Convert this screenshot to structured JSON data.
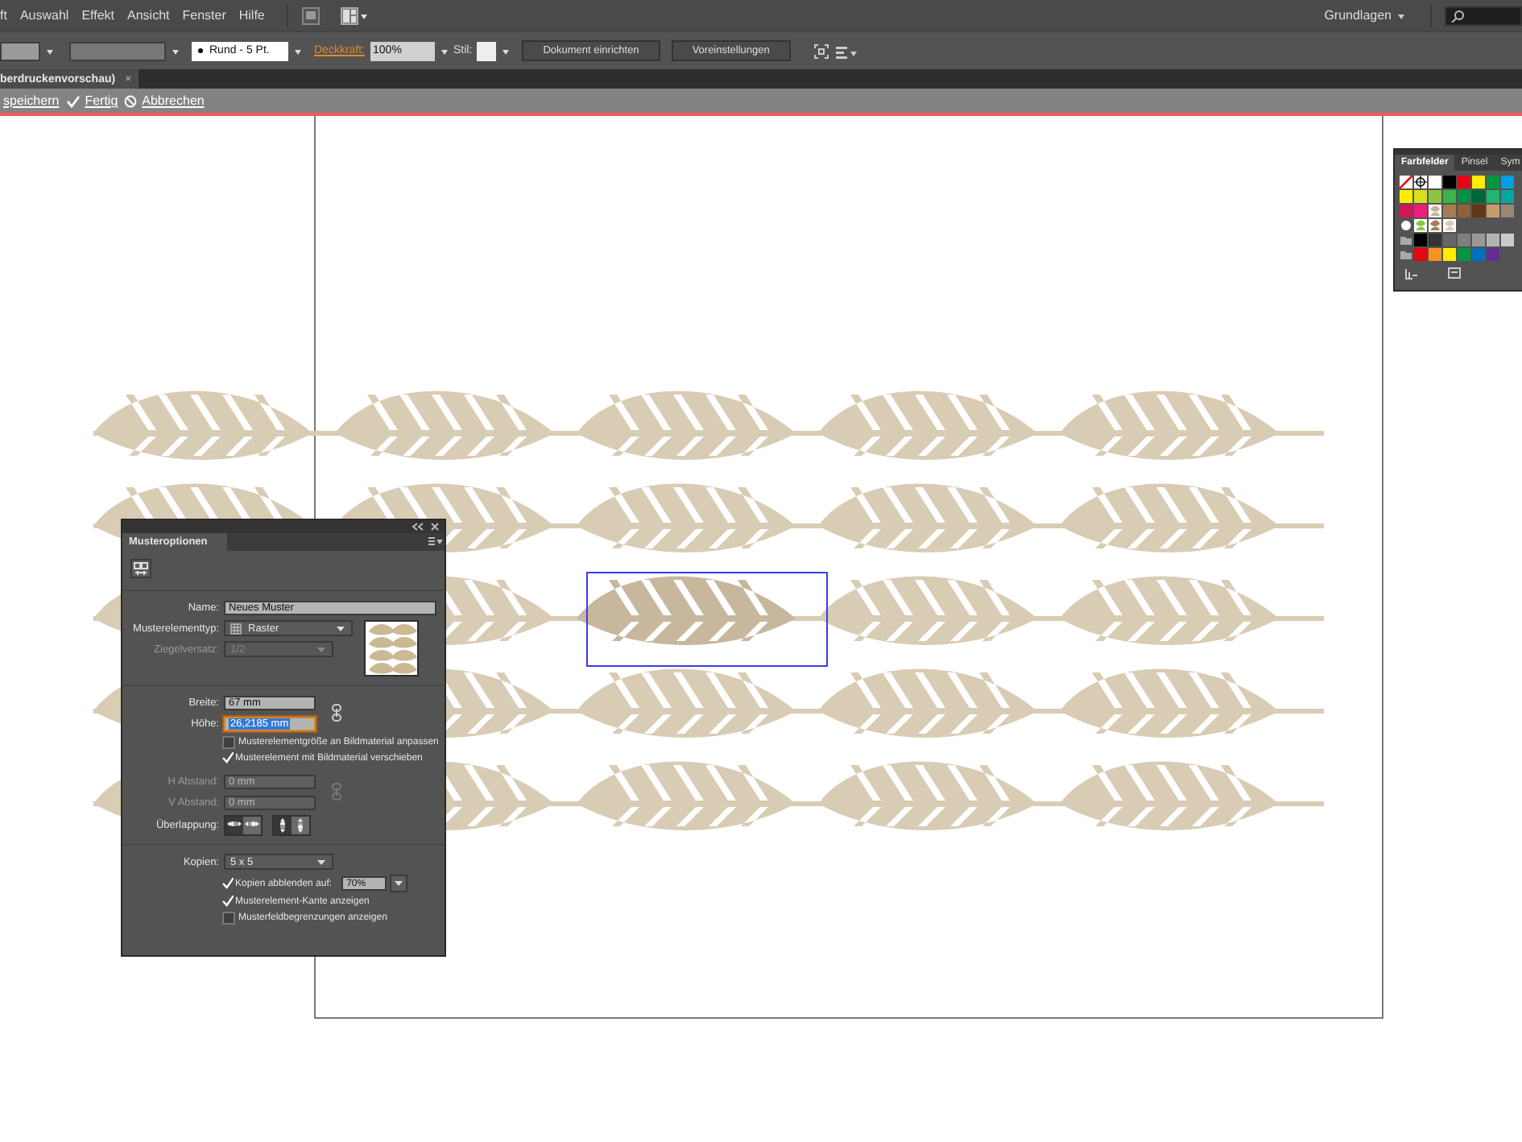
{
  "menu_bar": {
    "items": [
      "ft",
      "Auswahl",
      "Effekt",
      "Ansicht",
      "Fenster",
      "Hilfe"
    ],
    "workspace": "Grundlagen"
  },
  "control_bar": {
    "brush": "Rund - 5 Pt.",
    "opacity_label": "Deckkraft:",
    "opacity": "100%",
    "style_label": "Stil:",
    "buttons": [
      "Dokument einrichten",
      "Voreinstellungen"
    ]
  },
  "document_tab": {
    "title": "berdruckenvorschau)",
    "close": "×"
  },
  "pattern_edit_bar": {
    "items": [
      {
        "kind": "save",
        "label": "speichern"
      },
      {
        "kind": "done",
        "label": "Fertig"
      },
      {
        "kind": "cancel",
        "label": "Abbrechen"
      }
    ]
  },
  "pattern_options": {
    "title": "Musteroptionen",
    "name": {
      "label": "Name:",
      "value": "Neues Muster"
    },
    "tile_type": {
      "label": "Musterelementtyp:",
      "value": "Raster"
    },
    "brick_offset": {
      "label": "Ziegelversatz:",
      "value": "1/2",
      "disabled": true
    },
    "width": {
      "label": "Breite:",
      "value": "67 mm",
      "focused": false
    },
    "height": {
      "label": "Höhe:",
      "value": "26,2185 mm",
      "focused": true
    },
    "size_tile_to_art": {
      "label": "Musterelementgröße an Bildmaterial anpassen",
      "checked": false
    },
    "move_tile_with_art": {
      "label": "Musterelement mit Bildmaterial verschieben",
      "checked": true
    },
    "h_spacing": {
      "label": "H Abstand:",
      "value": "0 mm",
      "disabled": true
    },
    "v_spacing": {
      "label": "V Abstand:",
      "value": "0 mm",
      "disabled": true
    },
    "overlap": {
      "label": "Überlappung:",
      "buttons": [
        {
          "selected": true
        },
        {
          "selected": false
        },
        {
          "selected": true
        },
        {
          "selected": false
        }
      ]
    },
    "copies": {
      "label": "Kopien:",
      "value": "5 x 5"
    },
    "dim_copies": {
      "label": "Kopien abblenden auf:",
      "checked": true,
      "value": "70%"
    },
    "show_tile_edge": {
      "label": "Musterelement-Kante anzeigen",
      "checked": true
    },
    "show_swatch_bounds": {
      "label": "Musterfeldbegrenzungen anzeigen",
      "checked": false
    }
  },
  "swatches_panel": {
    "tabs": [
      {
        "label": "Farbfelder",
        "selected": true
      },
      {
        "label": "Pinsel",
        "selected": false
      },
      {
        "label": "Sym",
        "selected": false
      }
    ],
    "rows": [
      [
        {
          "kind": "none"
        },
        {
          "kind": "registration"
        },
        {
          "kind": "color",
          "color": "#ffffff"
        },
        {
          "kind": "color",
          "color": "#000000"
        },
        {
          "kind": "color",
          "color": "#e30613"
        },
        {
          "kind": "color",
          "color": "#ffed00"
        },
        {
          "kind": "color",
          "color": "#009640"
        },
        {
          "kind": "color",
          "color": "#009fe3"
        }
      ],
      [
        {
          "kind": "color",
          "color": "#ffed00"
        },
        {
          "kind": "color",
          "color": "#d9e021"
        },
        {
          "kind": "color",
          "color": "#8cc63f"
        },
        {
          "kind": "color",
          "color": "#39b54a"
        },
        {
          "kind": "color",
          "color": "#009245"
        },
        {
          "kind": "color",
          "color": "#006837"
        },
        {
          "kind": "color",
          "color": "#22b573"
        },
        {
          "kind": "color",
          "color": "#00a99d"
        }
      ],
      [
        {
          "kind": "color",
          "color": "#d4145a"
        },
        {
          "kind": "color",
          "color": "#ed1e79"
        },
        {
          "kind": "pattern",
          "color": "#c7b299"
        },
        {
          "kind": "color",
          "color": "#a67c52"
        },
        {
          "kind": "color",
          "color": "#8c6239"
        },
        {
          "kind": "color",
          "color": "#603813"
        },
        {
          "kind": "color",
          "color": "#c69c6d"
        },
        {
          "kind": "color",
          "color": "#998675"
        }
      ],
      [
        {
          "kind": "dots"
        },
        {
          "kind": "pattern",
          "color": "#8cc63f"
        },
        {
          "kind": "pattern",
          "color": "#a67c52"
        },
        {
          "kind": "pattern",
          "color": "#d9ccb4"
        }
      ],
      [
        {
          "kind": "folder"
        },
        {
          "kind": "color",
          "color": "#000000"
        },
        {
          "kind": "color",
          "color": "#333333"
        },
        {
          "kind": "color",
          "color": "#666666"
        },
        {
          "kind": "color",
          "color": "#808080"
        },
        {
          "kind": "color",
          "color": "#999999"
        },
        {
          "kind": "color",
          "color": "#b3b3b3"
        },
        {
          "kind": "color",
          "color": "#cccccc"
        }
      ],
      [
        {
          "kind": "folder"
        },
        {
          "kind": "color",
          "color": "#e30613"
        },
        {
          "kind": "color",
          "color": "#f7931e"
        },
        {
          "kind": "color",
          "color": "#ffed00"
        },
        {
          "kind": "color",
          "color": "#009640"
        },
        {
          "kind": "color",
          "color": "#0071bc"
        },
        {
          "kind": "color",
          "color": "#662d91"
        }
      ]
    ]
  }
}
